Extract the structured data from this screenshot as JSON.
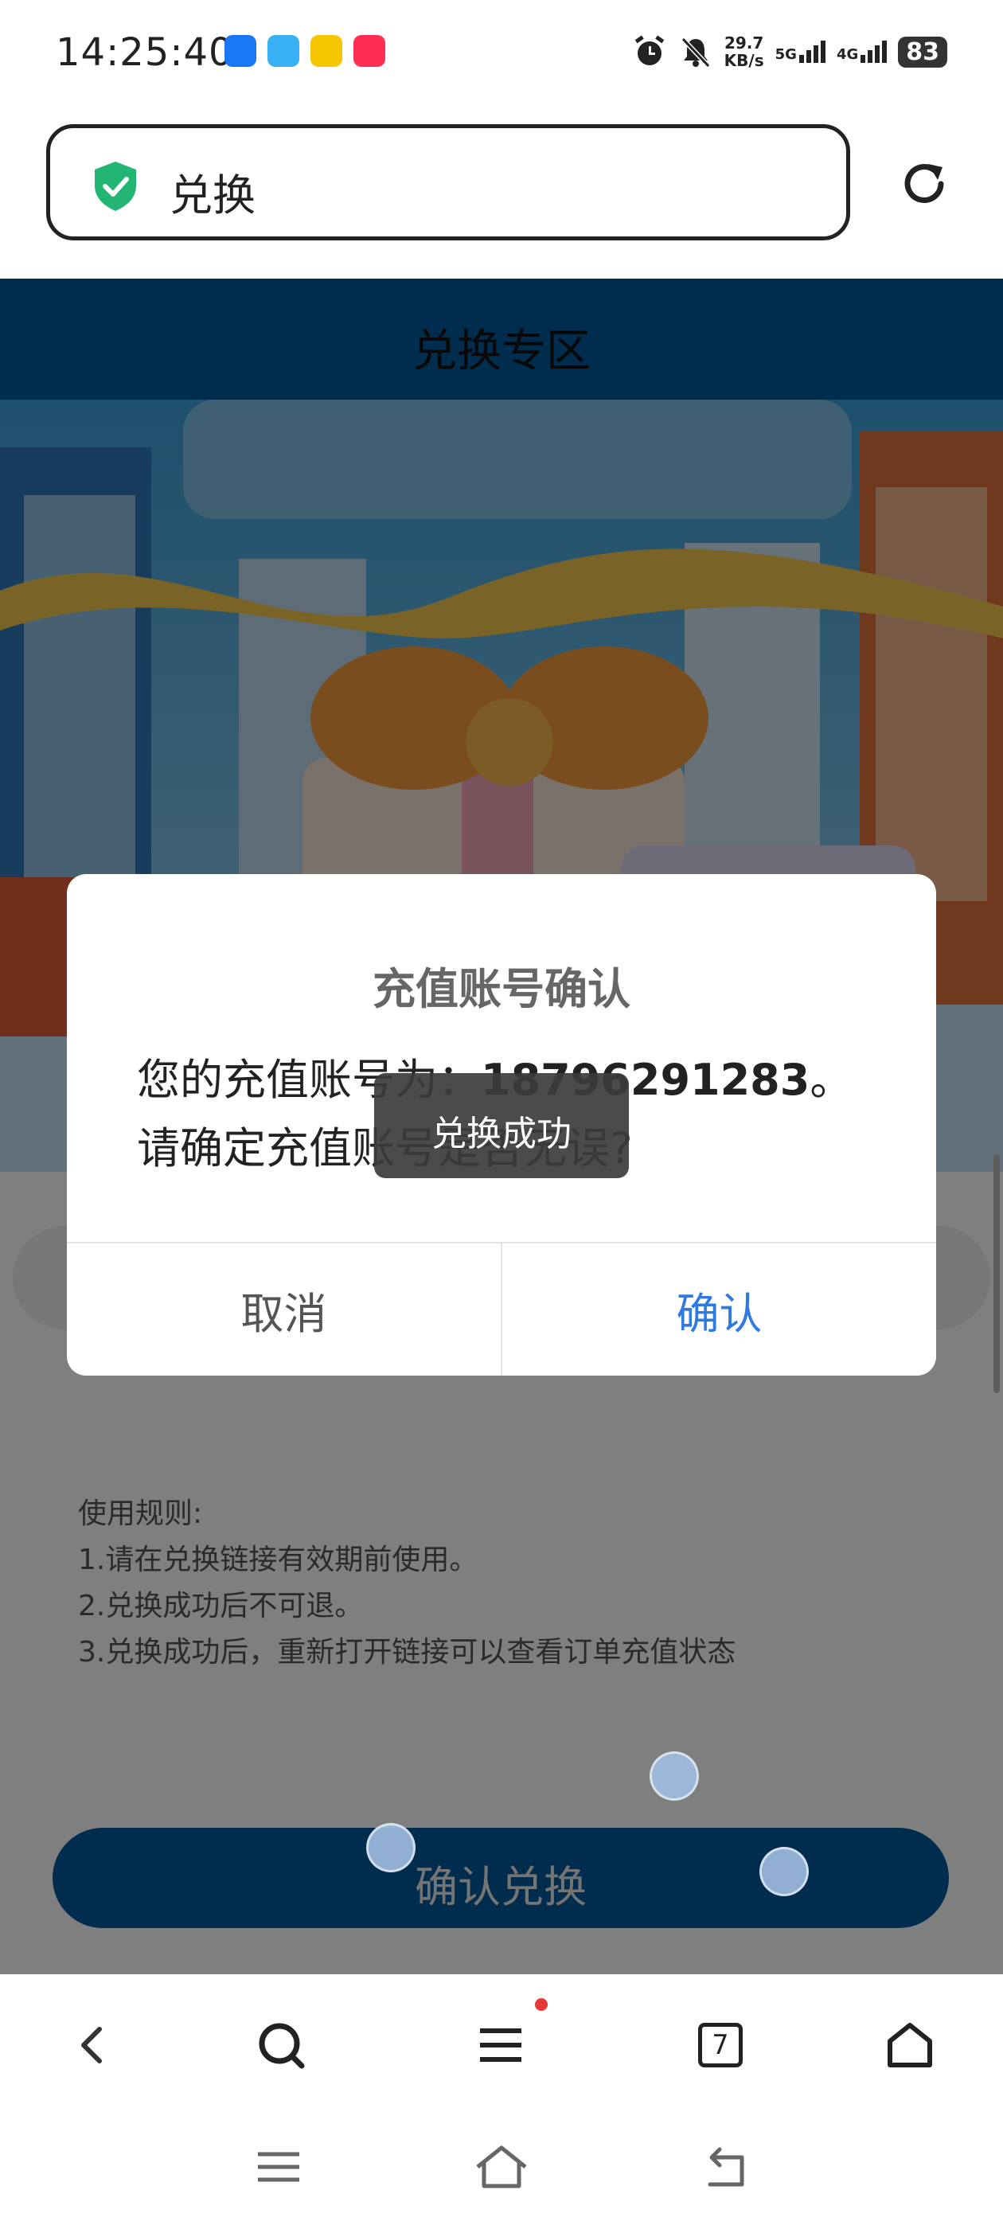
{
  "status_bar": {
    "time": "14:25:40",
    "net_speed_value": "29.7",
    "net_speed_unit": "KB/s",
    "sim1": "5G",
    "sim2": "4G",
    "battery": "83",
    "app_icon_colors": [
      "#1877f2",
      "#3ab0f5",
      "#f6c600",
      "#ff2d55"
    ]
  },
  "address_bar": {
    "text": "兑换",
    "secure_icon": "shield-check-icon",
    "secure_color": "#22b573",
    "reload_icon": "reload-icon"
  },
  "page": {
    "header_title": "兑换专区",
    "header_color": "#00589b",
    "rules": {
      "heading": "使用规则:",
      "items": [
        "1.请在兑换链接有效期前使用。",
        "2.兑换成功后不可退。",
        "3.兑换成功后，重新打开链接可以查看订单充值状态"
      ]
    },
    "confirm_button": "确认兑换"
  },
  "dialog": {
    "title": "充值账号确认",
    "message_prefix": "您的充值账号为：",
    "account": "18796291283",
    "message_suffix": "。",
    "message_line2": "请确定充值账号是否无误?",
    "cancel": "取消",
    "ok": "确认",
    "ok_color": "#2f7ae0"
  },
  "toast": {
    "text": "兑换成功"
  },
  "toolbar": {
    "tab_count": "7",
    "icons": [
      "back-icon",
      "search-icon",
      "menu-icon",
      "tabs-icon",
      "home-icon"
    ]
  },
  "system_nav": {
    "icons": [
      "recents-icon",
      "home-icon",
      "back-icon"
    ]
  }
}
